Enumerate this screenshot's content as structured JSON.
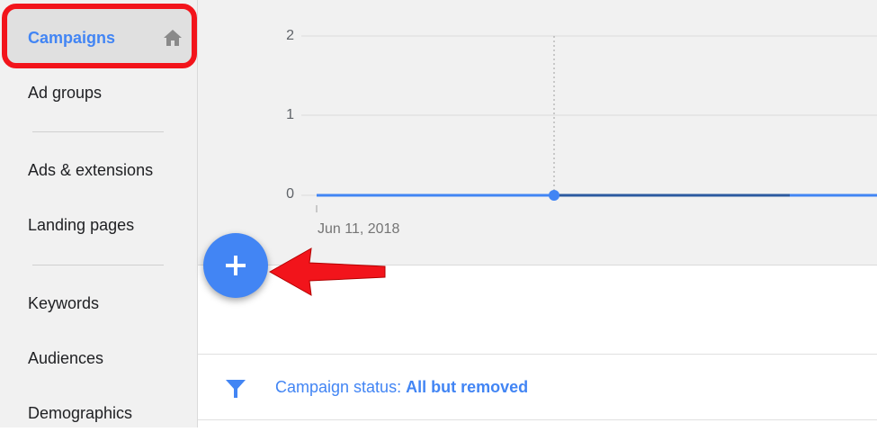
{
  "sidebar": {
    "items": [
      {
        "label": "Campaigns",
        "active": true
      },
      {
        "label": "Ad groups"
      },
      {
        "label": "Ads & extensions"
      },
      {
        "label": "Landing pages"
      },
      {
        "label": "Keywords"
      },
      {
        "label": "Audiences"
      },
      {
        "label": "Demographics"
      }
    ]
  },
  "chart_data": {
    "type": "line",
    "y_ticks": [
      "2",
      "1",
      "0"
    ],
    "ylim": [
      0,
      2
    ],
    "x_ticks": [
      "Jun 11, 2018"
    ],
    "series": [
      {
        "x": [
          "Jun 11, 2018"
        ],
        "values": [
          0
        ],
        "color": "#4285f4"
      }
    ],
    "grid": true
  },
  "fab": {
    "icon": "plus-icon",
    "color": "#4285f4"
  },
  "filter": {
    "label": "Campaign status:",
    "value": "All but removed",
    "icon": "filter-icon"
  },
  "colors": {
    "accent": "#4285f4",
    "annotation": "#f2141b",
    "sidebar_bg": "#f1f1f1"
  }
}
